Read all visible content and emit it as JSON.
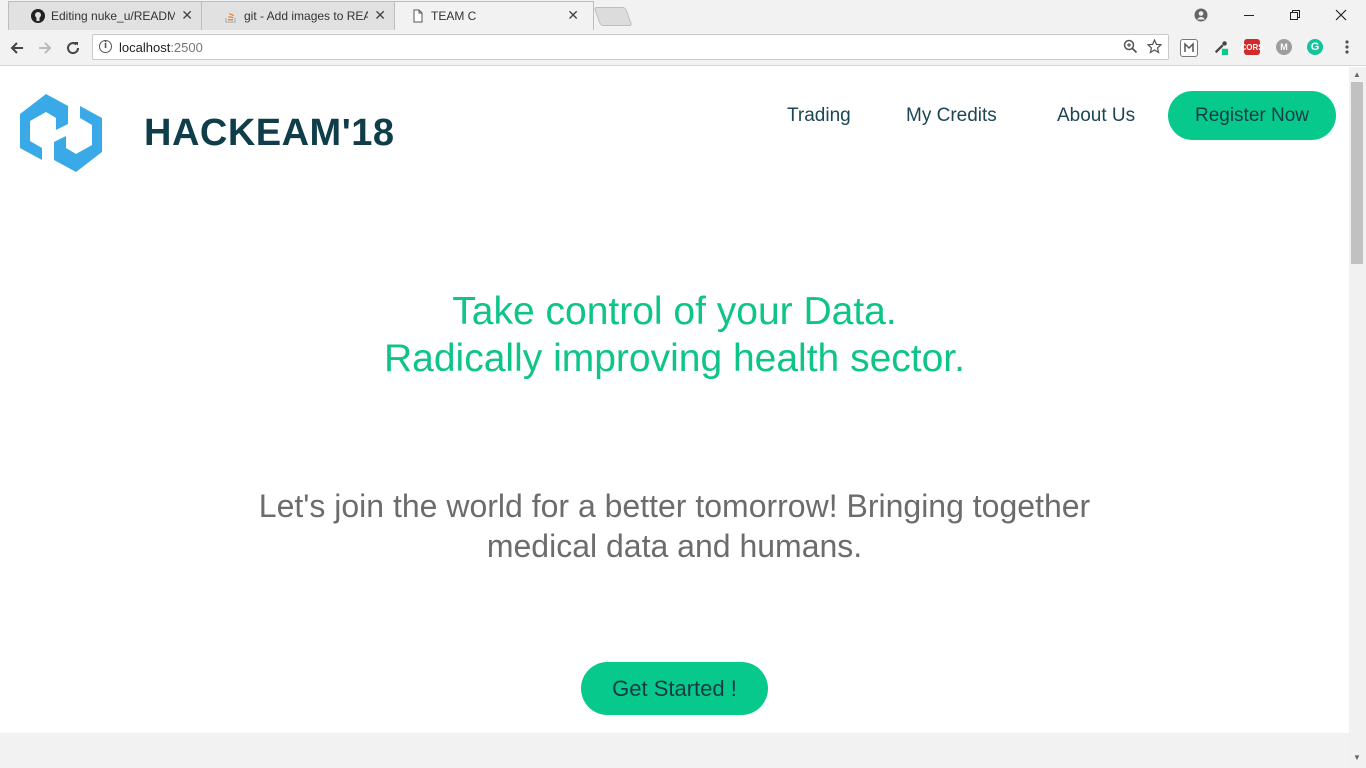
{
  "browser": {
    "tabs": [
      {
        "title": "Editing nuke_u/README",
        "icon": "github-icon"
      },
      {
        "title": "git - Add images to READ",
        "icon": "stackoverflow-icon"
      },
      {
        "title": "TEAM C",
        "icon": "page-icon",
        "active": true
      }
    ],
    "close_glyph": "✕",
    "url_host": "localhost",
    "url_port": ":2500",
    "extensions": [
      "metamask-icon",
      "eyedropper-icon",
      "cors-icon",
      "m-icon",
      "grammarly-icon"
    ],
    "ext_labels": {
      "cors": "CORS",
      "m": "M",
      "grammarly": "G"
    }
  },
  "site": {
    "brand": "HACKEAM'18",
    "nav": [
      "Trading",
      "My Credits",
      "About Us"
    ],
    "register": "Register Now",
    "headline_1": "Take control of your Data.",
    "headline_2": "Radically improving health sector.",
    "tagline_1": "Let's join the world for a better tomorrow! Bringing together",
    "tagline_2": "medical data and humans.",
    "cta": "Get Started !"
  },
  "colors": {
    "accent": "#08c98c",
    "headline": "#0ec489",
    "brand_text": "#0f3d4a",
    "logo": "#3aa9e8"
  }
}
